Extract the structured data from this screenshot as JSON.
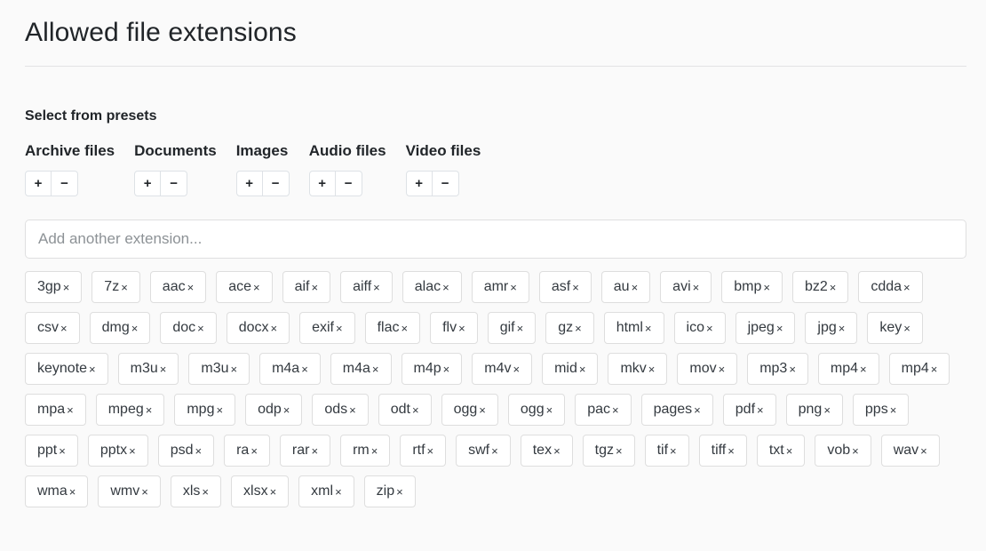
{
  "header": {
    "title": "Allowed file extensions"
  },
  "presets": {
    "heading": "Select from presets",
    "add_label": "+",
    "remove_label": "−",
    "groups": [
      {
        "label": "Archive files"
      },
      {
        "label": "Documents"
      },
      {
        "label": "Images"
      },
      {
        "label": "Audio files"
      },
      {
        "label": "Video files"
      }
    ]
  },
  "extension_input": {
    "value": "",
    "placeholder": "Add another extension..."
  },
  "tags": {
    "remove_glyph": "×",
    "items": [
      "3gp",
      "7z",
      "aac",
      "ace",
      "aif",
      "aiff",
      "alac",
      "amr",
      "asf",
      "au",
      "avi",
      "bmp",
      "bz2",
      "cdda",
      "csv",
      "dmg",
      "doc",
      "docx",
      "exif",
      "flac",
      "flv",
      "gif",
      "gz",
      "html",
      "ico",
      "jpeg",
      "jpg",
      "key",
      "keynote",
      "m3u",
      "m3u",
      "m4a",
      "m4a",
      "m4p",
      "m4v",
      "mid",
      "mkv",
      "mov",
      "mp3",
      "mp4",
      "mp4",
      "mpa",
      "mpeg",
      "mpg",
      "odp",
      "ods",
      "odt",
      "ogg",
      "ogg",
      "pac",
      "pages",
      "pdf",
      "png",
      "pps",
      "ppt",
      "pptx",
      "psd",
      "ra",
      "rar",
      "rm",
      "rtf",
      "swf",
      "tex",
      "tgz",
      "tif",
      "tiff",
      "txt",
      "vob",
      "wav",
      "wma",
      "wmv",
      "xls",
      "xlsx",
      "xml",
      "zip"
    ]
  },
  "colors": {
    "background": "#fafafa",
    "surface": "#ffffff",
    "border": "#dedede",
    "text": "#212529",
    "placeholder": "#8d9296"
  }
}
